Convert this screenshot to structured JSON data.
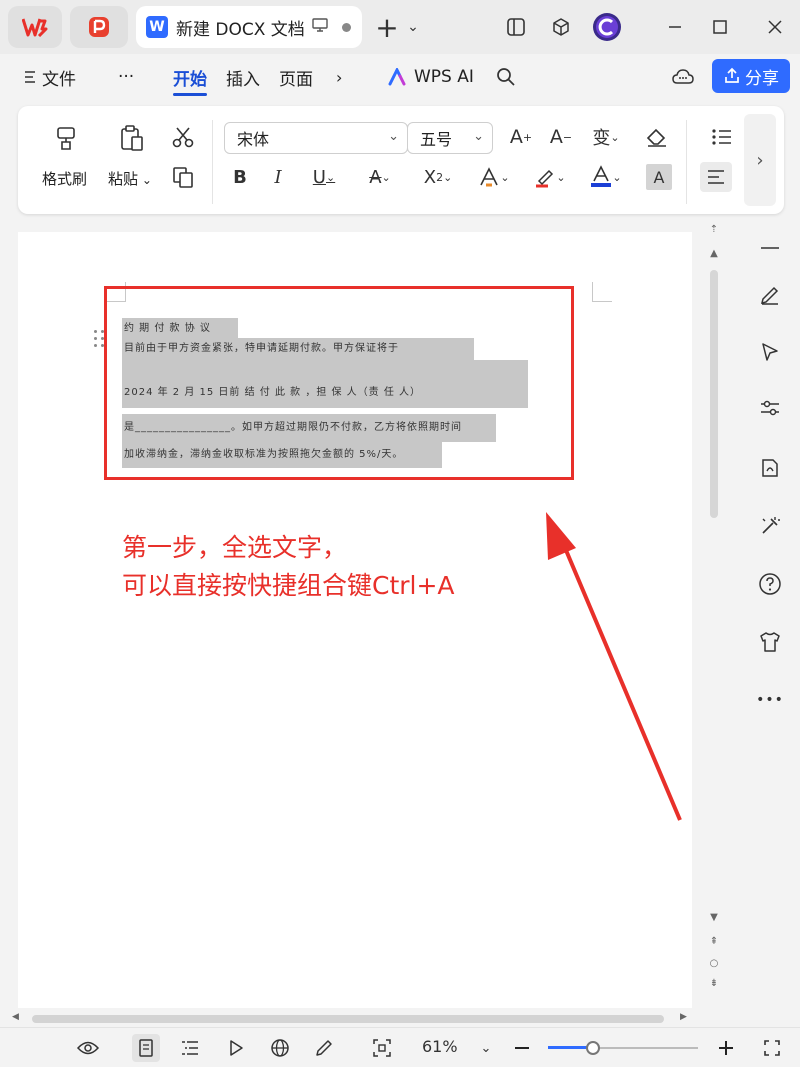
{
  "window": {
    "doc_tab_title": "新建 DOCX 文档",
    "colors": {
      "accent": "#2f6bff",
      "annotation": "#e8302a",
      "selection": "#c7c7c7"
    }
  },
  "menubar": {
    "file": "文件",
    "more": "···",
    "tabs": [
      "开始",
      "插入",
      "页面"
    ],
    "active_tab": "开始",
    "wps_ai": "WPS AI",
    "share": "分享"
  },
  "ribbon": {
    "format_painter": "格式刷",
    "paste": "粘贴",
    "font_name": "宋体",
    "font_size": "五号",
    "pinyin_glyph": "变"
  },
  "document": {
    "selected_lines": [
      "约 期 付 款 协 议",
      "目前由于甲方资金紧张，特申请延期付款。甲方保证将于",
      "2024    年    2    月  15    日前 结 付 此 款 ，担 保 人（责 任 人）",
      "是________________。如甲方超过期限仍不付款，乙方将依照期时间",
      "加收滞纳金，滞纳金收取标准为按照拖欠金额的 5%/天。"
    ],
    "annotation": {
      "line1": "第一步，全选文字，",
      "line2": "可以直接按快捷组合键Ctrl+A"
    }
  },
  "statusbar": {
    "zoom": "61%",
    "zoom_fraction": 0.3
  },
  "icons": [
    "wps-logo",
    "pdf-logo",
    "cube-icon",
    "avatar",
    "format-painter-icon",
    "paste-icon",
    "scissors-icon",
    "copy-icon",
    "eraser-icon",
    "pen-icon",
    "cursor-icon",
    "sliders-icon",
    "help-icon",
    "eye-icon",
    "globe-icon",
    "fullscreen-icon"
  ]
}
